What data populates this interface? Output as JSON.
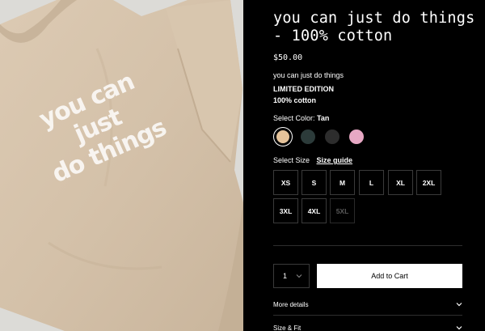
{
  "product": {
    "title": "you can just do things - 100% cotton",
    "price": "$50.00",
    "description": "you can just do things",
    "edition": "LIMITED EDITION",
    "material": "100% cotton",
    "shirt_print_lines": [
      "you can",
      "just",
      "do things"
    ]
  },
  "color_selector": {
    "label": "Select Color:",
    "selected": "Tan",
    "swatches": [
      {
        "name": "tan",
        "color": "#e5c39a",
        "selected": true
      },
      {
        "name": "dark-green",
        "color": "#2c3b3a",
        "selected": false
      },
      {
        "name": "charcoal",
        "color": "#2d2d2d",
        "selected": false
      },
      {
        "name": "pink",
        "color": "#e7a8c4",
        "selected": false
      }
    ]
  },
  "size_selector": {
    "label": "Select Size",
    "guide_label": "Size guide",
    "sizes": [
      {
        "label": "XS",
        "available": true
      },
      {
        "label": "S",
        "available": true
      },
      {
        "label": "M",
        "available": true
      },
      {
        "label": "L",
        "available": true
      },
      {
        "label": "XL",
        "available": true
      },
      {
        "label": "2XL",
        "available": true
      },
      {
        "label": "3XL",
        "available": true
      },
      {
        "label": "4XL",
        "available": true
      },
      {
        "label": "5XL",
        "available": false
      }
    ]
  },
  "cart": {
    "quantity": "1",
    "add_label": "Add to Cart"
  },
  "accordions": {
    "more_details": "More details",
    "size_fit": "Size & Fit"
  },
  "colors": {
    "background": "#000000",
    "shirt": "#d6c4ad",
    "image_background": "#d9d8d4"
  }
}
